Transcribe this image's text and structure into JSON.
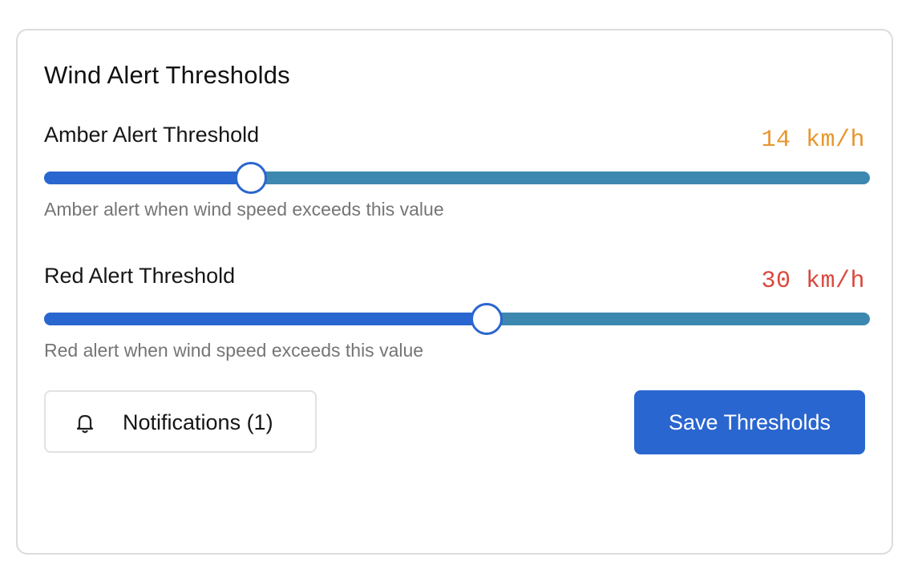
{
  "card": {
    "title": "Wind Alert Thresholds"
  },
  "amber": {
    "label": "Amber Alert Threshold",
    "value_text": "14 km/h",
    "value": 14,
    "max": 56,
    "hint": "Amber alert when wind speed exceeds this value",
    "value_color": "#e7962d"
  },
  "red": {
    "label": "Red Alert Threshold",
    "value_text": "30 km/h",
    "value": 30,
    "max": 56,
    "hint": "Red alert when wind speed exceeds this value",
    "value_color": "#d9493f"
  },
  "notifications": {
    "label": "Notifications (1)",
    "icon": "bell-icon"
  },
  "save": {
    "label": "Save Thresholds"
  },
  "colors": {
    "accent": "#2a66cf",
    "track": "#3d88b0"
  }
}
